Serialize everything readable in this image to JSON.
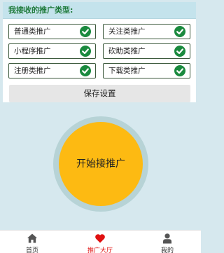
{
  "settings": {
    "title": "我接收的推广类型:",
    "options": [
      {
        "label": "普通类推广",
        "checked": true
      },
      {
        "label": "关注类推广",
        "checked": true
      },
      {
        "label": "小程序推广",
        "checked": true
      },
      {
        "label": "砍助类推广",
        "checked": true
      },
      {
        "label": "注册类推广",
        "checked": true
      },
      {
        "label": "下载类推广",
        "checked": true
      }
    ],
    "save_label": "保存设置"
  },
  "start_label": "开始接推广",
  "tabbar": {
    "items": [
      {
        "label": "首页",
        "icon": "home-icon",
        "active": false
      },
      {
        "label": "推广大厅",
        "icon": "heart-icon",
        "active": true
      },
      {
        "label": "我的",
        "icon": "user-icon",
        "active": false
      }
    ]
  },
  "colors": {
    "accent_green": "#1a8a3e",
    "start_button": "#fdba12",
    "active_tab": "#e01010",
    "page_bg": "#d6e8ee"
  }
}
